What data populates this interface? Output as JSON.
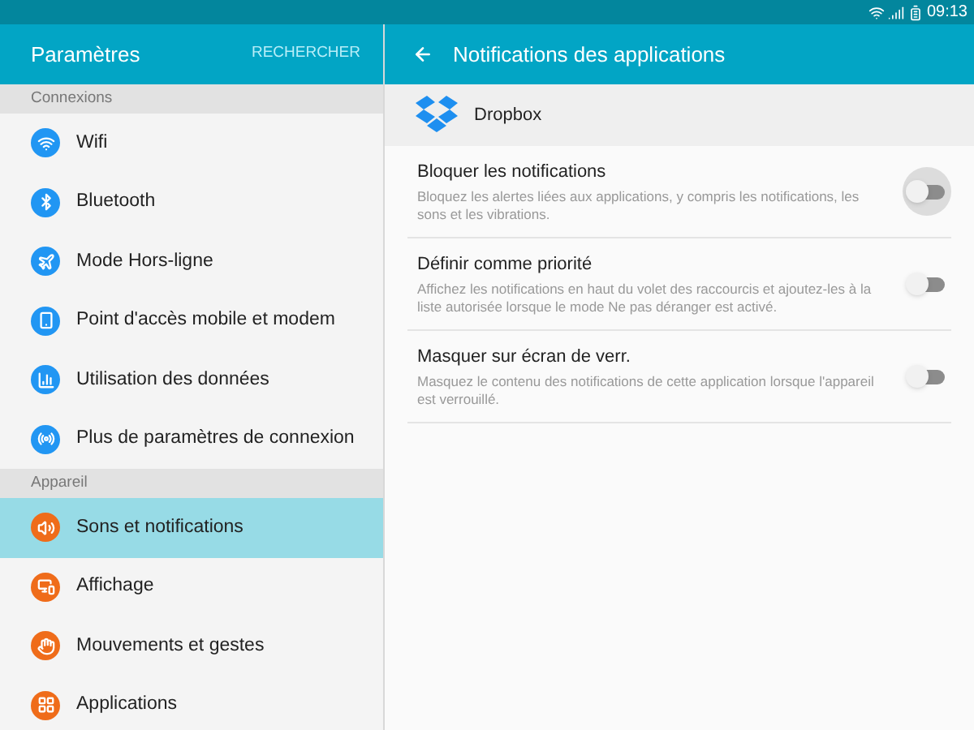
{
  "status_bar": {
    "time": "09:13"
  },
  "sidebar": {
    "title": "Paramètres",
    "search": "RECHERCHER",
    "sections": [
      {
        "title": "Connexions",
        "items": [
          {
            "label": "Wifi",
            "selected": false,
            "color": "#2196f3"
          },
          {
            "label": "Bluetooth",
            "selected": false,
            "color": "#2196f3"
          },
          {
            "label": "Mode Hors-ligne",
            "selected": false,
            "color": "#2196f3"
          },
          {
            "label": "Point d'accès mobile et modem",
            "selected": false,
            "color": "#2196f3"
          },
          {
            "label": "Utilisation des données",
            "selected": false,
            "color": "#2196f3"
          },
          {
            "label": "Plus de paramètres de connexion",
            "selected": false,
            "color": "#2196f3"
          }
        ]
      },
      {
        "title": "Appareil",
        "items": [
          {
            "label": "Sons et notifications",
            "selected": true,
            "color": "#ef6c1a"
          },
          {
            "label": "Affichage",
            "selected": false,
            "color": "#ef6c1a"
          },
          {
            "label": "Mouvements et gestes",
            "selected": false,
            "color": "#ef6c1a"
          },
          {
            "label": "Applications",
            "selected": false,
            "color": "#ef6c1a"
          }
        ]
      }
    ]
  },
  "detail": {
    "title": "Notifications des applications",
    "app": {
      "name": "Dropbox"
    },
    "settings": [
      {
        "title": "Bloquer les notifications",
        "description": "Bloquez les alertes liées aux applications, y compris les notifications, les sons et les vibrations.",
        "on": false,
        "pressed": true
      },
      {
        "title": "Définir comme priorité",
        "description": "Affichez les notifications en haut du volet des raccourcis et ajoutez-les à la liste autorisée lorsque le mode Ne pas déranger est activé.",
        "on": false,
        "pressed": false
      },
      {
        "title": "Masquer sur écran de verr.",
        "description": "Masquez le contenu des notifications de cette application lorsque l'appareil est verrouillé.",
        "on": false,
        "pressed": false
      }
    ]
  }
}
